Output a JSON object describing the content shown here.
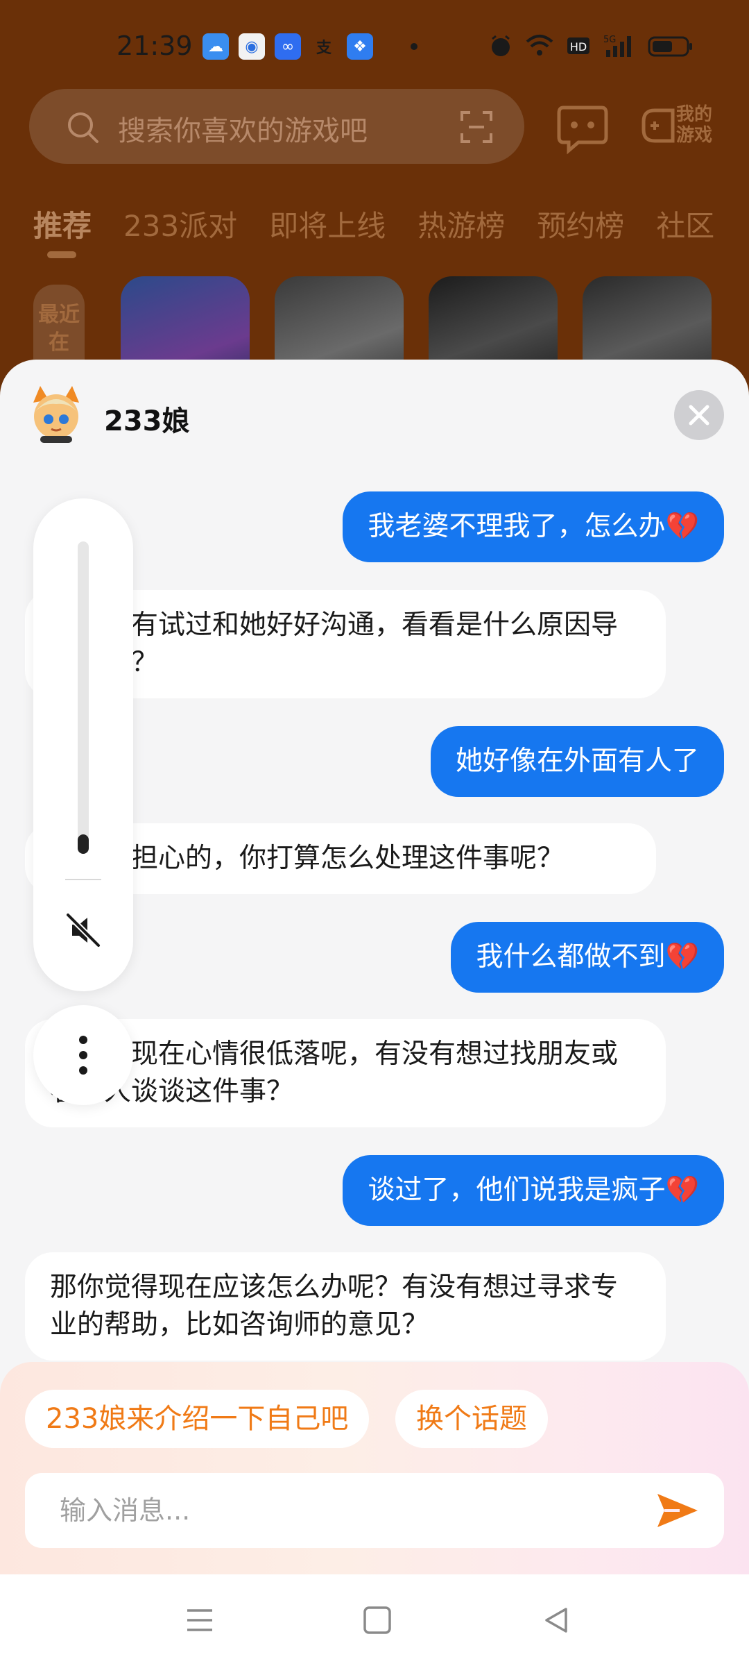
{
  "status_bar": {
    "time": "21:39",
    "apps": [
      "weather-icon",
      "search-app-icon",
      "infinity-app-icon",
      "alipay-icon",
      "link-app-icon"
    ],
    "right_icons": [
      "alarm-icon",
      "wifi-icon",
      "hd-icon",
      "5g-signal-icon",
      "battery-icon"
    ]
  },
  "background_app": {
    "search_placeholder": "搜索你喜欢的游戏吧",
    "my_games_label": "我的游戏",
    "tabs": [
      "推荐",
      "233派对",
      "即将上线",
      "热游榜",
      "预约榜",
      "社区"
    ],
    "recent_label": "最近在"
  },
  "sheet": {
    "title": "233娘",
    "messages": [
      {
        "role": "me",
        "text": "我老婆不理我了，怎么办💔"
      },
      {
        "role": "bot",
        "text": "你有没有试过和她好好沟通，看看是什么原因导致的呢？"
      },
      {
        "role": "me",
        "text": "她好像在外面有人了"
      },
      {
        "role": "bot",
        "text": "真让人担心的，你打算怎么处理这件事呢？"
      },
      {
        "role": "me",
        "text": "我什么都做不到💔"
      },
      {
        "role": "bot",
        "text": "看来你现在心情很低落呢，有没有想过找朋友或者家人谈谈这件事？"
      },
      {
        "role": "me",
        "text": "谈过了，他们说我是疯子💔"
      },
      {
        "role": "bot",
        "text": "那你觉得现在应该怎么办呢？有没有想过寻求专业的帮助，比如咨询师的意见？"
      }
    ],
    "suggestions": [
      "233娘来介绍一下自己吧",
      "换个话题"
    ],
    "input_placeholder": "输入消息..."
  },
  "volume": {
    "level": 0.04,
    "muted": true
  },
  "colors": {
    "accent": "#1677f0",
    "chip_text": "#f07a16",
    "send": "#f07a16"
  }
}
